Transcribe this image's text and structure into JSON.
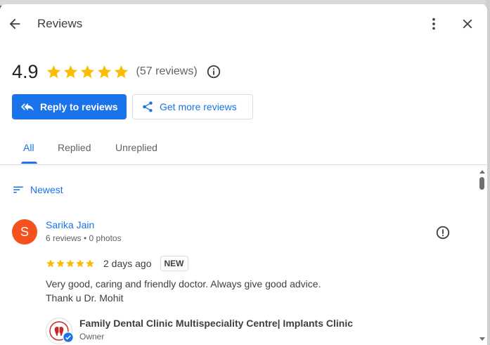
{
  "header": {
    "title": "Reviews",
    "back_icon": "arrow-back-icon",
    "more_icon": "more-vert-icon",
    "close_icon": "close-icon"
  },
  "summary": {
    "score": "4.9",
    "stars": 5,
    "review_count": "(57 reviews)",
    "info_icon": "info-icon",
    "star_color": "#fbbc04"
  },
  "actions": {
    "reply_label": "Reply to reviews",
    "get_more_label": "Get more reviews",
    "primary_color": "#1a73e8"
  },
  "tabs": [
    {
      "label": "All",
      "active": true
    },
    {
      "label": "Replied",
      "active": false
    },
    {
      "label": "Unreplied",
      "active": false
    }
  ],
  "sort": {
    "label": "Newest",
    "icon": "sort-icon"
  },
  "reviews": [
    {
      "avatar_letter": "S",
      "avatar_color": "#f4511e",
      "name": "Sarika Jain",
      "meta": "6 reviews • 0 photos",
      "rating": 5,
      "time": "2 days ago",
      "badge": "NEW",
      "text_line1": "Very good, caring and friendly doctor. Always give good advice.",
      "text_line2": "Thank u Dr. Mohit",
      "owner": {
        "name": "Family Dental Clinic Multispeciality Centre| Implants Clinic",
        "role": "Owner"
      }
    }
  ]
}
